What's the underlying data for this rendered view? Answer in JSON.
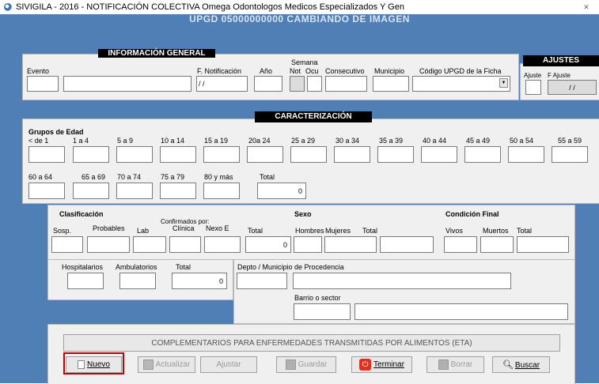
{
  "window": {
    "title": "SIVIGILA - 2016 - NOTIFICACIÓN COLECTIVA Omega Odontologos Medicos Especializados Y Gen",
    "close": "✕",
    "banner": "UPGD 05000000000 CAMBIANDO DE IMAGEN"
  },
  "general": {
    "header": "INFORMACIÓN GENERAL",
    "evento_label": "Evento",
    "fnotif_label": "F. Notificación",
    "fnotif_value": "/ /",
    "anio_label": "Año",
    "semana_label": "Semana",
    "not_label": "Not",
    "ocu_label": "Ocu",
    "consecutivo_label": "Consecutivo",
    "municipio_label": "Municipio",
    "codigo_label": "Código UPGD de la Ficha"
  },
  "ajustes": {
    "header": "AJUSTES",
    "ajuste_label": "Ajuste",
    "fajuste_label": "F Ajuste",
    "fajuste_value": "/ /"
  },
  "caracterizacion": {
    "header": "CARACTERIZACIÓN",
    "grupos_label": "Grupos de Edad",
    "row1": [
      "< de 1",
      "1 a 4",
      "5 a 9",
      "10 a 14",
      "15 a 19",
      "20a 24",
      "25 a 29",
      "30 a 34",
      "35 a 39",
      "40 a 44",
      "45 a 49",
      "50 a 54",
      "55 a 59"
    ],
    "row2": [
      "60 a 64",
      "65 a 69",
      "70 a 74",
      "75 a 79",
      "80 y más"
    ],
    "total_label": "Total",
    "total_value": "0"
  },
  "clasificacion": {
    "header": "Clasificación",
    "confirmados_label": "Confirmados por:",
    "sosp": "Sosp.",
    "probables": "Probables",
    "lab": "Lab",
    "clinica": "Clínica",
    "nexo": "Nexo E",
    "total_label": "Total",
    "total_value": "0"
  },
  "sexo": {
    "header": "Sexo",
    "hombres": "Hombres",
    "mujeres": "Mujeres",
    "total_label": "Total"
  },
  "condicion": {
    "header": "Condición Final",
    "vivos": "Vivos",
    "muertos": "Muertos",
    "total_label": "Total"
  },
  "atencion": {
    "hospitalarios": "Hospitalarios",
    "ambulatorios": "Ambulatorios",
    "total_label": "Total",
    "total_value": "0"
  },
  "procedencia": {
    "depto_label": "Depto / Municipio de Procedencia",
    "barrio_label": "Barrio o sector"
  },
  "eta": {
    "button_label": "COMPLEMENTARIOS PARA ENFERMEDADES TRANSMITIDAS POR ALIMENTOS (ETA)"
  },
  "toolbar": {
    "nuevo": "Nuevo",
    "actualizar": "Actualizar",
    "ajustar": "Ajustar",
    "guardar": "Guardar",
    "terminar": "Terminar",
    "borrar": "Borrar",
    "buscar": "Buscar"
  },
  "colors": {
    "background_blue": "#4f7fb4",
    "panel_gray": "#f0f0f0",
    "highlight_red": "#c00000",
    "terminar_icon": "#e03020"
  }
}
